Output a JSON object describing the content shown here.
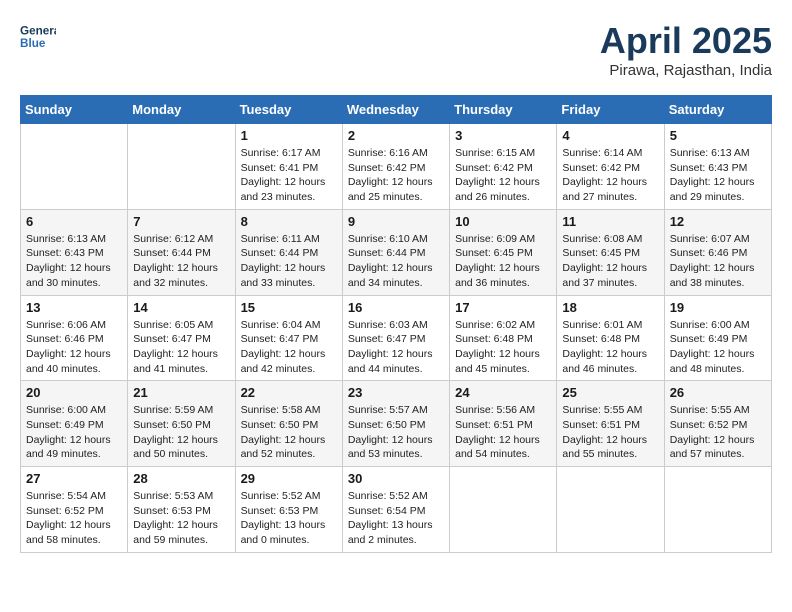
{
  "header": {
    "logo_line1": "General",
    "logo_line2": "Blue",
    "month_title": "April 2025",
    "location": "Pirawa, Rajasthan, India"
  },
  "columns": [
    "Sunday",
    "Monday",
    "Tuesday",
    "Wednesday",
    "Thursday",
    "Friday",
    "Saturday"
  ],
  "weeks": [
    [
      {
        "day": "",
        "sunrise": "",
        "sunset": "",
        "daylight": ""
      },
      {
        "day": "",
        "sunrise": "",
        "sunset": "",
        "daylight": ""
      },
      {
        "day": "1",
        "sunrise": "Sunrise: 6:17 AM",
        "sunset": "Sunset: 6:41 PM",
        "daylight": "Daylight: 12 hours and 23 minutes."
      },
      {
        "day": "2",
        "sunrise": "Sunrise: 6:16 AM",
        "sunset": "Sunset: 6:42 PM",
        "daylight": "Daylight: 12 hours and 25 minutes."
      },
      {
        "day": "3",
        "sunrise": "Sunrise: 6:15 AM",
        "sunset": "Sunset: 6:42 PM",
        "daylight": "Daylight: 12 hours and 26 minutes."
      },
      {
        "day": "4",
        "sunrise": "Sunrise: 6:14 AM",
        "sunset": "Sunset: 6:42 PM",
        "daylight": "Daylight: 12 hours and 27 minutes."
      },
      {
        "day": "5",
        "sunrise": "Sunrise: 6:13 AM",
        "sunset": "Sunset: 6:43 PM",
        "daylight": "Daylight: 12 hours and 29 minutes."
      }
    ],
    [
      {
        "day": "6",
        "sunrise": "Sunrise: 6:13 AM",
        "sunset": "Sunset: 6:43 PM",
        "daylight": "Daylight: 12 hours and 30 minutes."
      },
      {
        "day": "7",
        "sunrise": "Sunrise: 6:12 AM",
        "sunset": "Sunset: 6:44 PM",
        "daylight": "Daylight: 12 hours and 32 minutes."
      },
      {
        "day": "8",
        "sunrise": "Sunrise: 6:11 AM",
        "sunset": "Sunset: 6:44 PM",
        "daylight": "Daylight: 12 hours and 33 minutes."
      },
      {
        "day": "9",
        "sunrise": "Sunrise: 6:10 AM",
        "sunset": "Sunset: 6:44 PM",
        "daylight": "Daylight: 12 hours and 34 minutes."
      },
      {
        "day": "10",
        "sunrise": "Sunrise: 6:09 AM",
        "sunset": "Sunset: 6:45 PM",
        "daylight": "Daylight: 12 hours and 36 minutes."
      },
      {
        "day": "11",
        "sunrise": "Sunrise: 6:08 AM",
        "sunset": "Sunset: 6:45 PM",
        "daylight": "Daylight: 12 hours and 37 minutes."
      },
      {
        "day": "12",
        "sunrise": "Sunrise: 6:07 AM",
        "sunset": "Sunset: 6:46 PM",
        "daylight": "Daylight: 12 hours and 38 minutes."
      }
    ],
    [
      {
        "day": "13",
        "sunrise": "Sunrise: 6:06 AM",
        "sunset": "Sunset: 6:46 PM",
        "daylight": "Daylight: 12 hours and 40 minutes."
      },
      {
        "day": "14",
        "sunrise": "Sunrise: 6:05 AM",
        "sunset": "Sunset: 6:47 PM",
        "daylight": "Daylight: 12 hours and 41 minutes."
      },
      {
        "day": "15",
        "sunrise": "Sunrise: 6:04 AM",
        "sunset": "Sunset: 6:47 PM",
        "daylight": "Daylight: 12 hours and 42 minutes."
      },
      {
        "day": "16",
        "sunrise": "Sunrise: 6:03 AM",
        "sunset": "Sunset: 6:47 PM",
        "daylight": "Daylight: 12 hours and 44 minutes."
      },
      {
        "day": "17",
        "sunrise": "Sunrise: 6:02 AM",
        "sunset": "Sunset: 6:48 PM",
        "daylight": "Daylight: 12 hours and 45 minutes."
      },
      {
        "day": "18",
        "sunrise": "Sunrise: 6:01 AM",
        "sunset": "Sunset: 6:48 PM",
        "daylight": "Daylight: 12 hours and 46 minutes."
      },
      {
        "day": "19",
        "sunrise": "Sunrise: 6:00 AM",
        "sunset": "Sunset: 6:49 PM",
        "daylight": "Daylight: 12 hours and 48 minutes."
      }
    ],
    [
      {
        "day": "20",
        "sunrise": "Sunrise: 6:00 AM",
        "sunset": "Sunset: 6:49 PM",
        "daylight": "Daylight: 12 hours and 49 minutes."
      },
      {
        "day": "21",
        "sunrise": "Sunrise: 5:59 AM",
        "sunset": "Sunset: 6:50 PM",
        "daylight": "Daylight: 12 hours and 50 minutes."
      },
      {
        "day": "22",
        "sunrise": "Sunrise: 5:58 AM",
        "sunset": "Sunset: 6:50 PM",
        "daylight": "Daylight: 12 hours and 52 minutes."
      },
      {
        "day": "23",
        "sunrise": "Sunrise: 5:57 AM",
        "sunset": "Sunset: 6:50 PM",
        "daylight": "Daylight: 12 hours and 53 minutes."
      },
      {
        "day": "24",
        "sunrise": "Sunrise: 5:56 AM",
        "sunset": "Sunset: 6:51 PM",
        "daylight": "Daylight: 12 hours and 54 minutes."
      },
      {
        "day": "25",
        "sunrise": "Sunrise: 5:55 AM",
        "sunset": "Sunset: 6:51 PM",
        "daylight": "Daylight: 12 hours and 55 minutes."
      },
      {
        "day": "26",
        "sunrise": "Sunrise: 5:55 AM",
        "sunset": "Sunset: 6:52 PM",
        "daylight": "Daylight: 12 hours and 57 minutes."
      }
    ],
    [
      {
        "day": "27",
        "sunrise": "Sunrise: 5:54 AM",
        "sunset": "Sunset: 6:52 PM",
        "daylight": "Daylight: 12 hours and 58 minutes."
      },
      {
        "day": "28",
        "sunrise": "Sunrise: 5:53 AM",
        "sunset": "Sunset: 6:53 PM",
        "daylight": "Daylight: 12 hours and 59 minutes."
      },
      {
        "day": "29",
        "sunrise": "Sunrise: 5:52 AM",
        "sunset": "Sunset: 6:53 PM",
        "daylight": "Daylight: 13 hours and 0 minutes."
      },
      {
        "day": "30",
        "sunrise": "Sunrise: 5:52 AM",
        "sunset": "Sunset: 6:54 PM",
        "daylight": "Daylight: 13 hours and 2 minutes."
      },
      {
        "day": "",
        "sunrise": "",
        "sunset": "",
        "daylight": ""
      },
      {
        "day": "",
        "sunrise": "",
        "sunset": "",
        "daylight": ""
      },
      {
        "day": "",
        "sunrise": "",
        "sunset": "",
        "daylight": ""
      }
    ]
  ]
}
